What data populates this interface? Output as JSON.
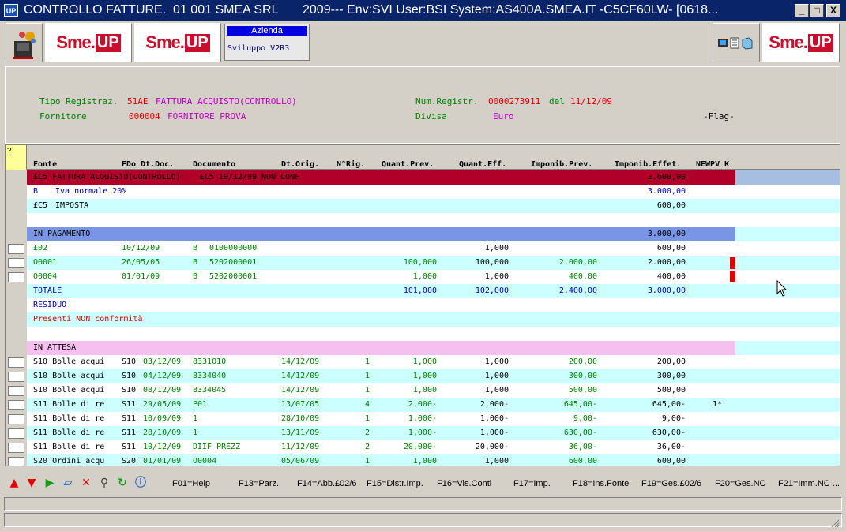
{
  "window": {
    "title": "CONTROLLO FATTURE.  01 001 SMEA SRL       2009--- Env:SVI User:BSI System:AS400A.SMEA.IT -C5CF60LW- [0618...",
    "app_icon": "UP",
    "controls": {
      "minimize": "_",
      "maximize": "□",
      "close": "X"
    }
  },
  "toolbar": {
    "logo_sme": "Sme.",
    "logo_up": "UP",
    "azienda_label": "Azienda",
    "azienda_value": "Sviluppo V2R3"
  },
  "header": {
    "tipo_label": "Tipo Registraz.",
    "tipo_code": "51AE",
    "tipo_desc": "FATTURA ACQUISTO(CONTROLLO)",
    "num_label": "Num.Registr.",
    "num_value": "0000273911",
    "del_label": "del",
    "del_value": "11/12/09",
    "fornitore_label": "Fornitore",
    "fornitore_code": "000004",
    "fornitore_name": "FORNITORE PROVA",
    "divisa_label": "Divisa",
    "divisa_value": "Euro",
    "flag_label": "-Flag-"
  },
  "grid": {
    "corner": "?",
    "columns": [
      "Fonte",
      "FDo Dt.Doc.",
      "Documento",
      "Dt.Orig.",
      "N°Rig.",
      "Quant.Prev.",
      "Quant.Eff.",
      "Imponib.Prev.",
      "Imponib.Effet.",
      "NEWPV K"
    ],
    "band_fattura": {
      "text": "£C5 FATTURA ACQUISTO(CONTROLLO)    £C5 10/12/09 NON CONF",
      "value": "3.600,00"
    },
    "iva": {
      "code": "B",
      "desc": "Iva normale 20%",
      "value": "3.000,00"
    },
    "imposta": {
      "code": "£C5",
      "desc": "IMPOSTA",
      "value": "600,00"
    },
    "in_pagamento": {
      "label": "IN PAGAMENTO",
      "value": "3.000,00"
    },
    "pag_rows": [
      {
        "fonte": "£02",
        "dt_doc": "10/12/09",
        "fdo": "B",
        "documento": "0100000000",
        "q_prev": "",
        "q_eff": "1,000",
        "imp_prev": "",
        "imp_eff": "600,00",
        "flag": false
      },
      {
        "fonte": "O0001",
        "dt_doc": "26/05/05",
        "fdo": "B",
        "documento": "5202000001",
        "q_prev": "100,000",
        "q_eff": "100,000",
        "imp_prev": "2.000,00",
        "imp_eff": "2.000,00",
        "flag": true
      },
      {
        "fonte": "O0004",
        "dt_doc": "01/01/09",
        "fdo": "B",
        "documento": "5202000001",
        "q_prev": "1,000",
        "q_eff": "1,000",
        "imp_prev": "400,00",
        "imp_eff": "400,00",
        "flag": true
      }
    ],
    "totale": {
      "label": "TOTALE",
      "q_prev": "101,000",
      "q_eff": "102,000",
      "imp_prev": "2.400,00",
      "imp_eff": "3.000,00"
    },
    "residuo": "RESIDUO",
    "non_conf": "Presenti NON conformità",
    "in_attesa": "IN ATTESA",
    "attesa_rows": [
      {
        "fonte": "S10 Bolle acqui",
        "fdo": "S10",
        "dt_doc": "03/12/09",
        "documento": "8331010",
        "dt_orig": "14/12/09",
        "n_rig": "1",
        "q_prev": "1,000",
        "q_eff": "1,000",
        "imp_prev": "200,00",
        "imp_eff": "200,00",
        "newpv": ""
      },
      {
        "fonte": "S10 Bolle acqui",
        "fdo": "S10",
        "dt_doc": "04/12/09",
        "documento": "8334040",
        "dt_orig": "14/12/09",
        "n_rig": "1",
        "q_prev": "1,000",
        "q_eff": "1,000",
        "imp_prev": "300,00",
        "imp_eff": "300,00",
        "newpv": ""
      },
      {
        "fonte": "S10 Bolle acqui",
        "fdo": "S10",
        "dt_doc": "08/12/09",
        "documento": "8334045",
        "dt_orig": "14/12/09",
        "n_rig": "1",
        "q_prev": "1,000",
        "q_eff": "1,000",
        "imp_prev": "500,00",
        "imp_eff": "500,00",
        "newpv": ""
      },
      {
        "fonte": "S11 Bolle di re",
        "fdo": "S11",
        "dt_doc": "29/05/09",
        "documento": "P01",
        "dt_orig": "13/07/05",
        "n_rig": "4",
        "q_prev": "2,000-",
        "q_eff": "2,000-",
        "imp_prev": "645,00-",
        "imp_eff": "645,00-",
        "newpv": "1*"
      },
      {
        "fonte": "S11 Bolle di re",
        "fdo": "S11",
        "dt_doc": "10/09/09",
        "documento": "1",
        "dt_orig": "28/10/09",
        "n_rig": "1",
        "q_prev": "1,000-",
        "q_eff": "1,000-",
        "imp_prev": "9,00-",
        "imp_eff": "9,00-",
        "newpv": ""
      },
      {
        "fonte": "S11 Bolle di re",
        "fdo": "S11",
        "dt_doc": "28/10/09",
        "documento": "1",
        "dt_orig": "13/11/09",
        "n_rig": "2",
        "q_prev": "1,000-",
        "q_eff": "1,000-",
        "imp_prev": "630,00-",
        "imp_eff": "630,00-",
        "newpv": ""
      },
      {
        "fonte": "S11 Bolle di re",
        "fdo": "S11",
        "dt_doc": "10/12/09",
        "documento": "DIIF PREZZ",
        "dt_orig": "11/12/09",
        "n_rig": "2",
        "q_prev": "20,000-",
        "q_eff": "20,000-",
        "imp_prev": "36,00-",
        "imp_eff": "36,00-",
        "newpv": ""
      },
      {
        "fonte": "S20 Ordini acqu",
        "fdo": "S20",
        "dt_doc": "01/01/09",
        "documento": "O0004",
        "dt_orig": "05/06/09",
        "n_rig": "1",
        "q_prev": "1,000",
        "q_eff": "1,000",
        "imp_prev": "600,00",
        "imp_eff": "600,00",
        "newpv": ""
      }
    ]
  },
  "function_keys": [
    "F01=Help",
    "F13=Parz.",
    "F14=Abb.£02/6",
    "F15=Distr.Imp.",
    "F16=Vis.Conti",
    "F17=Imp.",
    "F18=Ins.Fonte",
    "F19=Ges.£02/6",
    "F20=Ges.NC",
    "F21=Imm.NC ..."
  ],
  "colors": {
    "title_bar": "#0a246a",
    "red_band": "#b0002a",
    "blue_band": "#7b95e6",
    "pink_band": "#f5c0f0",
    "cyan_row": "#ccffff",
    "text_green": "#008000",
    "text_blue": "#0000c0"
  }
}
